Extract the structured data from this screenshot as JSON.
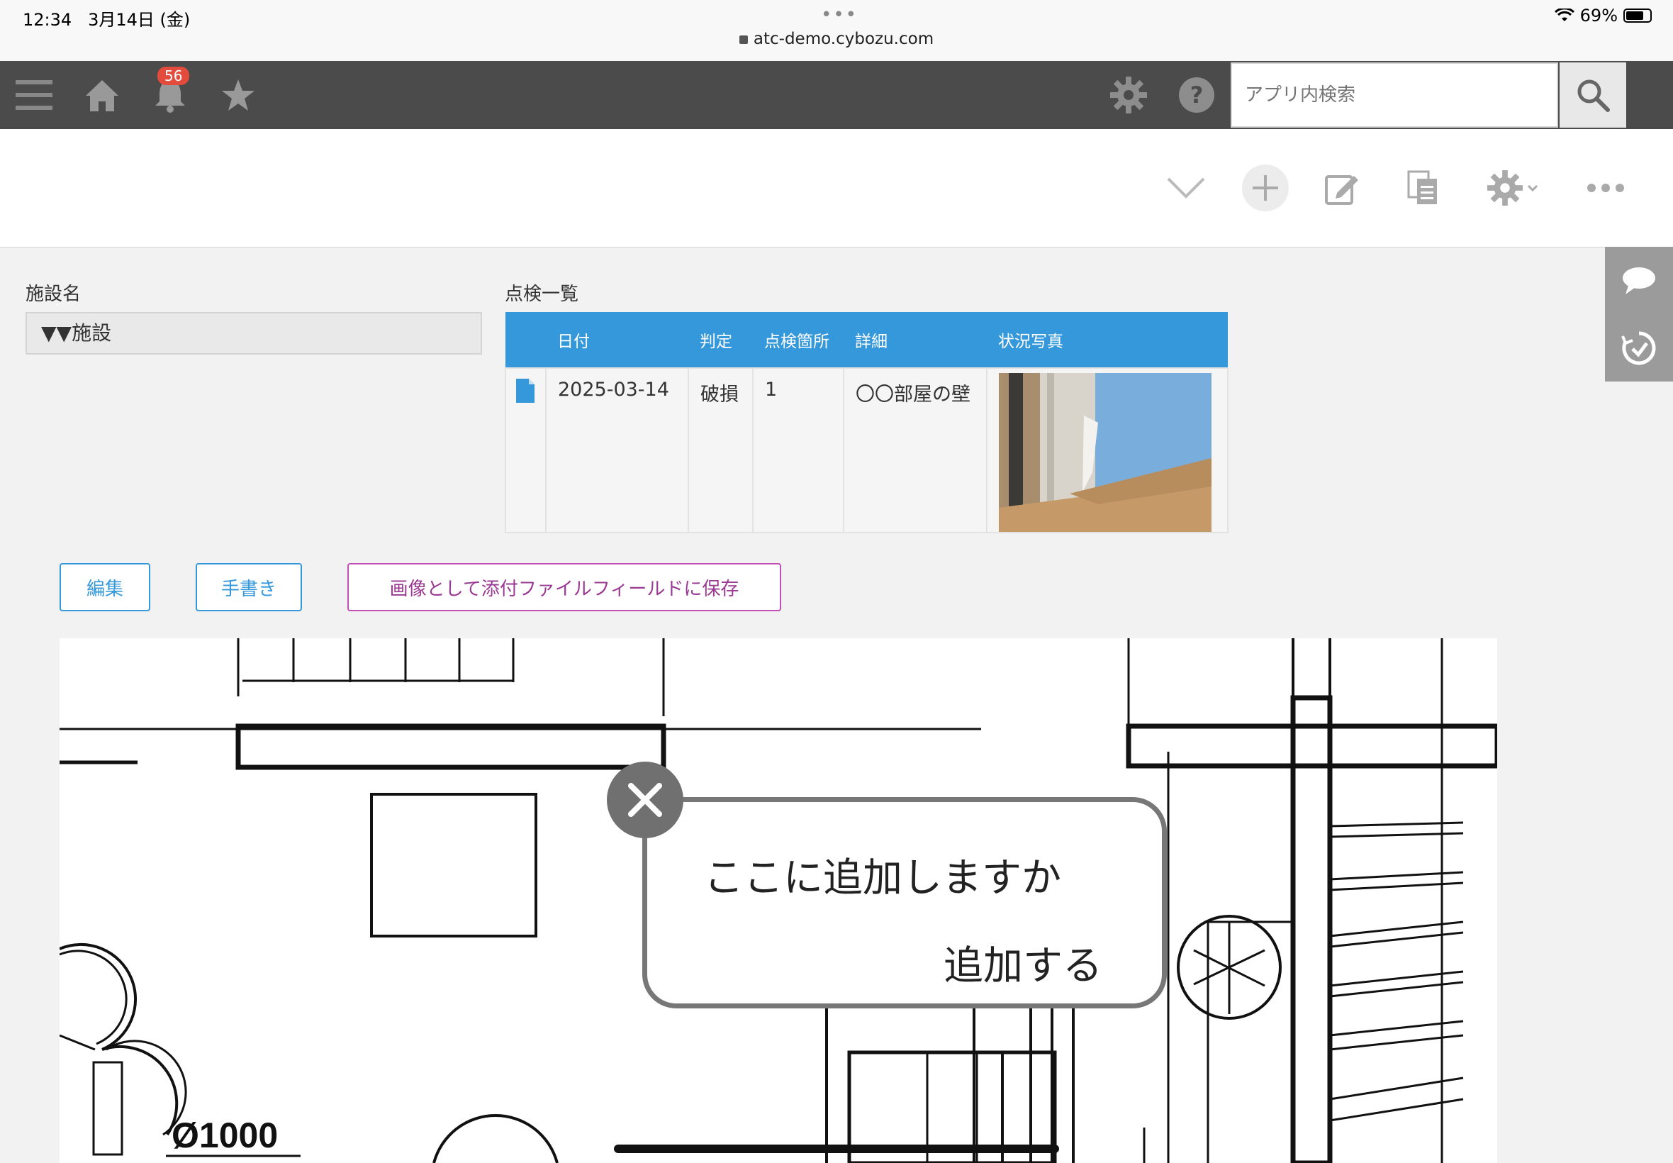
{
  "status_bar": {
    "time": "12:34",
    "date": "3月14日 (金)",
    "dots": "•••",
    "url": "atc-demo.cybozu.com",
    "battery": "69%"
  },
  "header": {
    "notification_count": "56",
    "search_placeholder": "アプリ内検索"
  },
  "fields": {
    "facility_label": "施設名",
    "facility_value": "▼▼施設",
    "inspection_label": "点検一覧"
  },
  "table": {
    "headers": [
      "日付",
      "判定",
      "点検箇所",
      "詳細",
      "状況写真"
    ],
    "rows": [
      {
        "date": "2025-03-14",
        "judgement": "破損",
        "location": "1",
        "detail": "〇〇部屋の壁"
      }
    ]
  },
  "buttons": {
    "edit": "編集",
    "handwrite": "手書き",
    "save_image": "画像として添付ファイルフィールドに保存"
  },
  "drawing": {
    "dimension_text": "Ø1000"
  },
  "popup": {
    "question": "ここに追加しますか",
    "add": "追加する"
  },
  "colors": {
    "header_bg": "#4b4b4b",
    "accent": "#3498db",
    "badge": "#e34b3c",
    "purple_button": "#9a3a93"
  }
}
